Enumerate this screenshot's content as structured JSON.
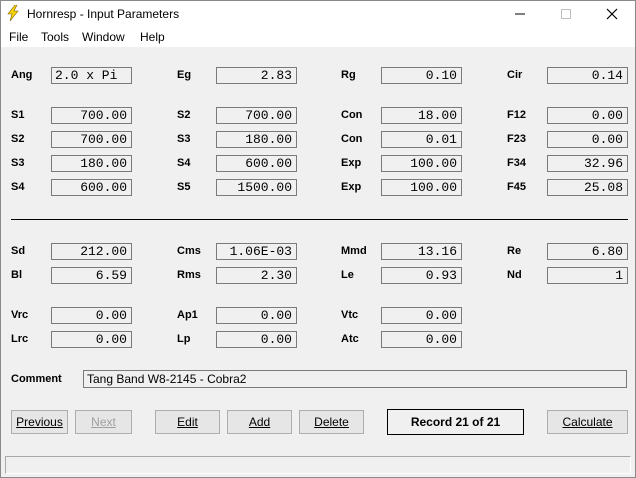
{
  "window": {
    "title": "Hornresp - Input Parameters"
  },
  "menu": [
    "File",
    "Tools",
    "Window",
    "Help"
  ],
  "rows": [
    [
      {
        "label": "Ang",
        "value": "2.0 x Pi",
        "align": "left"
      },
      {
        "label": "Eg",
        "value": "2.83"
      },
      {
        "label": "Rg",
        "value": "0.10"
      },
      {
        "label": "Cir",
        "value": "0.14"
      }
    ],
    [
      {
        "label": "S1",
        "value": "700.00"
      },
      {
        "label": "S2",
        "value": "700.00"
      },
      {
        "label": "Con",
        "value": "18.00"
      },
      {
        "label": "F12",
        "value": "0.00"
      }
    ],
    [
      {
        "label": "S2",
        "value": "700.00"
      },
      {
        "label": "S3",
        "value": "180.00"
      },
      {
        "label": "Con",
        "value": "0.01"
      },
      {
        "label": "F23",
        "value": "0.00"
      }
    ],
    [
      {
        "label": "S3",
        "value": "180.00"
      },
      {
        "label": "S4",
        "value": "600.00"
      },
      {
        "label": "Exp",
        "value": "100.00"
      },
      {
        "label": "F34",
        "value": "32.96"
      }
    ],
    [
      {
        "label": "S4",
        "value": "600.00"
      },
      {
        "label": "S5",
        "value": "1500.00"
      },
      {
        "label": "Exp",
        "value": "100.00"
      },
      {
        "label": "F45",
        "value": "25.08"
      }
    ],
    [
      {
        "label": "Sd",
        "value": "212.00"
      },
      {
        "label": "Cms",
        "value": "1.06E-03"
      },
      {
        "label": "Mmd",
        "value": "13.16"
      },
      {
        "label": "Re",
        "value": "6.80"
      }
    ],
    [
      {
        "label": "Bl",
        "value": "6.59"
      },
      {
        "label": "Rms",
        "value": "2.30"
      },
      {
        "label": "Le",
        "value": "0.93"
      },
      {
        "label": "Nd",
        "value": "1"
      }
    ],
    [
      {
        "label": "Vrc",
        "value": "0.00"
      },
      {
        "label": "Ap1",
        "value": "0.00"
      },
      {
        "label": "Vtc",
        "value": "0.00"
      }
    ],
    [
      {
        "label": "Lrc",
        "value": "0.00"
      },
      {
        "label": "Lp",
        "value": "0.00"
      },
      {
        "label": "Atc",
        "value": "0.00"
      }
    ]
  ],
  "comment": {
    "label": "Comment",
    "value": "Tang Band W8-2145 - Cobra2"
  },
  "buttons": {
    "previous": "Previous",
    "next": "Next",
    "edit": "Edit",
    "add": "Add",
    "delete": "Delete",
    "calculate": "Calculate"
  },
  "record": "Record 21 of 21"
}
